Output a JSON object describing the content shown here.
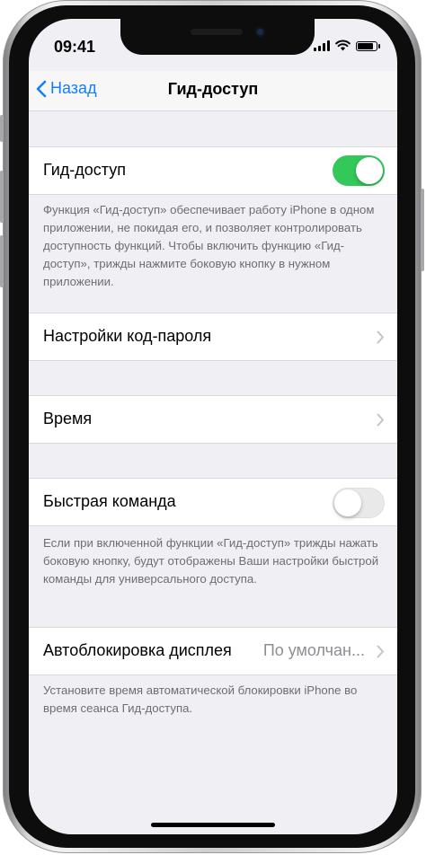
{
  "status": {
    "time": "09:41",
    "battery_level": 0.85
  },
  "nav": {
    "back_label": "Назад",
    "title": "Гид-доступ"
  },
  "guided_access": {
    "label": "Гид-доступ",
    "enabled": true,
    "footnote": "Функция «Гид-доступ» обеспечивает работу iPhone в одном приложении, не покидая его, и позволяет контролировать доступность функций. Чтобы включить функцию «Гид-доступ», трижды нажмите боковую кнопку в нужном приложении."
  },
  "passcode_settings": {
    "label": "Настройки код-пароля"
  },
  "time_limits": {
    "label": "Время"
  },
  "accessibility_shortcut": {
    "label": "Быстрая команда",
    "enabled": false,
    "footnote": "Если при включенной функции «Гид-доступ» трижды нажать боковую кнопку, будут отображены Ваши настройки быстрой команды для универсального доступа."
  },
  "auto_lock": {
    "label": "Автоблокировка дисплея",
    "value": "По умолчан...",
    "footnote": "Установите время автоматической блокировки iPhone во время сеанса Гид-доступа."
  },
  "colors": {
    "accent": "#157efb",
    "toggle_on": "#34c759",
    "background": "#efeff4"
  }
}
